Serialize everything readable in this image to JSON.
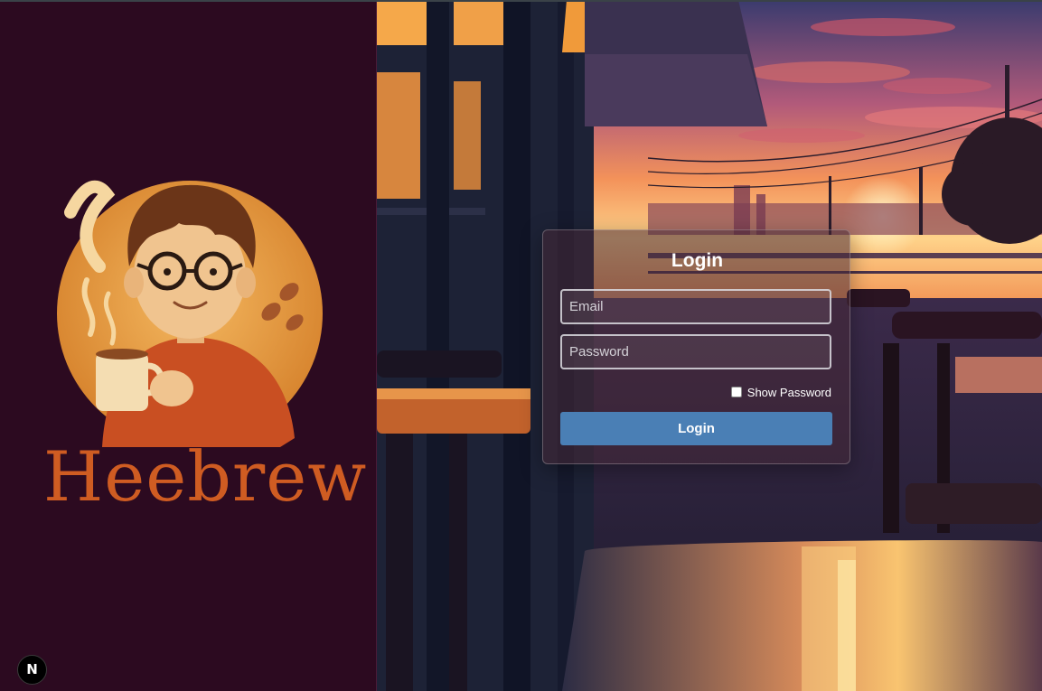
{
  "brand": {
    "name": "Heebrew",
    "logo_icon": "coffee-boy-mascot",
    "color": "#cf5c22"
  },
  "login": {
    "title": "Login",
    "email_placeholder": "Email",
    "password_placeholder": "Password",
    "show_password_label": "Show Password",
    "button_label": "Login",
    "button_color": "#4a7fb5"
  },
  "dev_badge": {
    "label": "N",
    "icon": "nextjs-icon"
  },
  "colors": {
    "left_panel": "#2c0a20"
  }
}
